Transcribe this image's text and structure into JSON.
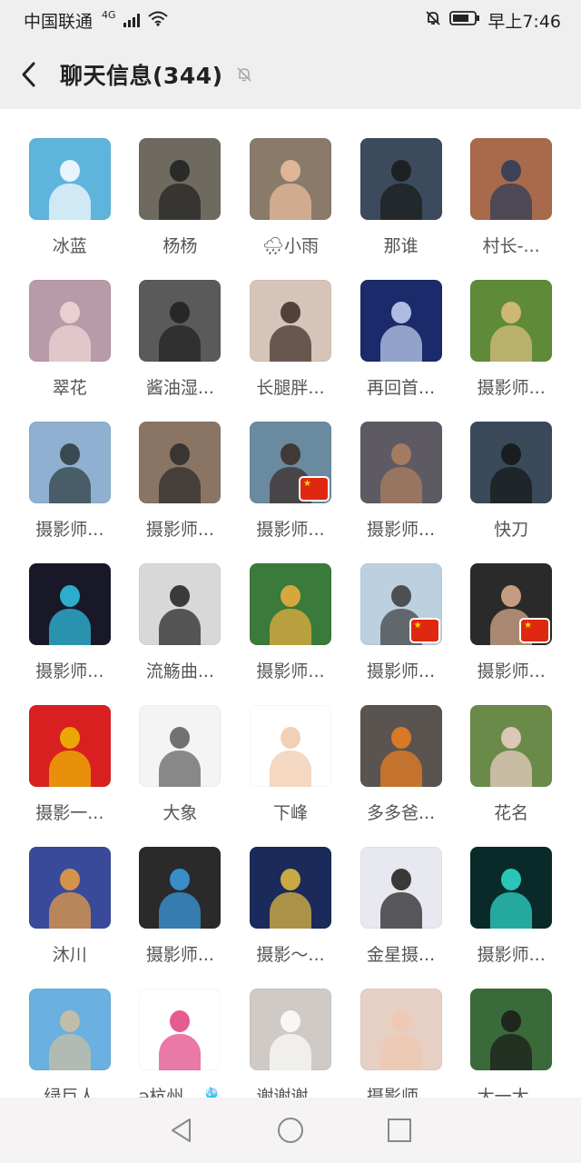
{
  "status_bar": {
    "carrier": "中国联通",
    "network": "4G",
    "time": "早上7:46",
    "icons": [
      "signal-icon",
      "wifi-icon",
      "mute-bell-icon",
      "battery-icon"
    ]
  },
  "header": {
    "back_icon": "chevron-left-icon",
    "title": "聊天信息(344)",
    "mute_icon": "muted-bell-icon"
  },
  "members": [
    {
      "name": "冰蓝",
      "bg": "#5fb4dc",
      "fg": "#ffffff"
    },
    {
      "name": "杨杨",
      "bg": "#6e6a60",
      "fg": "#1f1f1f"
    },
    {
      "name": "🌧小雨",
      "bg": "#8a7a6a",
      "fg": "#f0c0a0"
    },
    {
      "name": "那谁",
      "bg": "#3b4a5c",
      "fg": "#1a1a1a"
    },
    {
      "name": "村长-...",
      "bg": "#a86a4a",
      "fg": "#2a3a5a"
    },
    {
      "name": "翠花",
      "bg": "#b89aa8",
      "fg": "#f2d8d8"
    },
    {
      "name": "酱油湿...",
      "bg": "#5a5a5a",
      "fg": "#1e1e1e"
    },
    {
      "name": "长腿胖...",
      "bg": "#d6c4b8",
      "fg": "#3a2a22"
    },
    {
      "name": "再回首...",
      "bg": "#1a2a6a",
      "fg": "#c8d6f4"
    },
    {
      "name": "摄影师...",
      "bg": "#5e8a3a",
      "fg": "#e0c080"
    },
    {
      "name": "摄影师...",
      "bg": "#8fb0d0",
      "fg": "#2a3a3a"
    },
    {
      "name": "摄影师...",
      "bg": "#8a7464",
      "fg": "#2a2a2a"
    },
    {
      "name": "摄影师...",
      "bg": "#6a8aa0",
      "fg": "#3a2a22",
      "flag": true
    },
    {
      "name": "摄影师...",
      "bg": "#5e5a64",
      "fg": "#b08060"
    },
    {
      "name": "快刀",
      "bg": "#3a4a5a",
      "fg": "#151515"
    },
    {
      "name": "摄影师...",
      "bg": "#181828",
      "fg": "#30c8e8"
    },
    {
      "name": "流觞曲...",
      "bg": "#d8d8d8",
      "fg": "#1e1e1e"
    },
    {
      "name": "摄影师...",
      "bg": "#3a7a3a",
      "fg": "#f0b040"
    },
    {
      "name": "摄影师...",
      "bg": "#bcd0e0",
      "fg": "#3a3a3a",
      "flag": true
    },
    {
      "name": "摄影师...",
      "bg": "#2a2a2a",
      "fg": "#e0b090",
      "flag": true
    },
    {
      "name": "摄影一...",
      "bg": "#d82020",
      "fg": "#f0c000"
    },
    {
      "name": "大象",
      "bg": "#f4f4f4",
      "fg": "#5a5a5a"
    },
    {
      "name": "下峰",
      "bg": "#ffffff",
      "fg": "#f0c8a8"
    },
    {
      "name": "多多爸...",
      "bg": "#5a5450",
      "fg": "#f08020"
    },
    {
      "name": "花名",
      "bg": "#6a8a4a",
      "fg": "#f0d0c8"
    },
    {
      "name": "沐川",
      "bg": "#3a4a9a",
      "fg": "#f0a040"
    },
    {
      "name": "摄影师...",
      "bg": "#2a2a2a",
      "fg": "#3aa0e8"
    },
    {
      "name": "摄影～...",
      "bg": "#1a2a5a",
      "fg": "#e8c040"
    },
    {
      "name": "金星摄...",
      "bg": "#e8e8f0",
      "fg": "#1a1a1a"
    },
    {
      "name": "摄影师...",
      "bg": "#0a2a2a",
      "fg": "#30e0d0"
    },
    {
      "name": "绿巨人",
      "bg": "#6ab0e0",
      "fg": "#d0c0a0"
    },
    {
      "name": "ə杭州...🎐",
      "bg": "#ffffff",
      "fg": "#e04080"
    },
    {
      "name": "谢谢谢...",
      "bg": "#cfcac6",
      "fg": "#ffffff"
    },
    {
      "name": "摄影师...",
      "bg": "#e6d0c4",
      "fg": "#f0c8b0"
    },
    {
      "name": "大一大...",
      "bg": "#3a6a3a",
      "fg": "#1a1a1a"
    }
  ],
  "nav_bar": {
    "icons": [
      "nav-back-icon",
      "nav-home-icon",
      "nav-recents-icon"
    ]
  }
}
